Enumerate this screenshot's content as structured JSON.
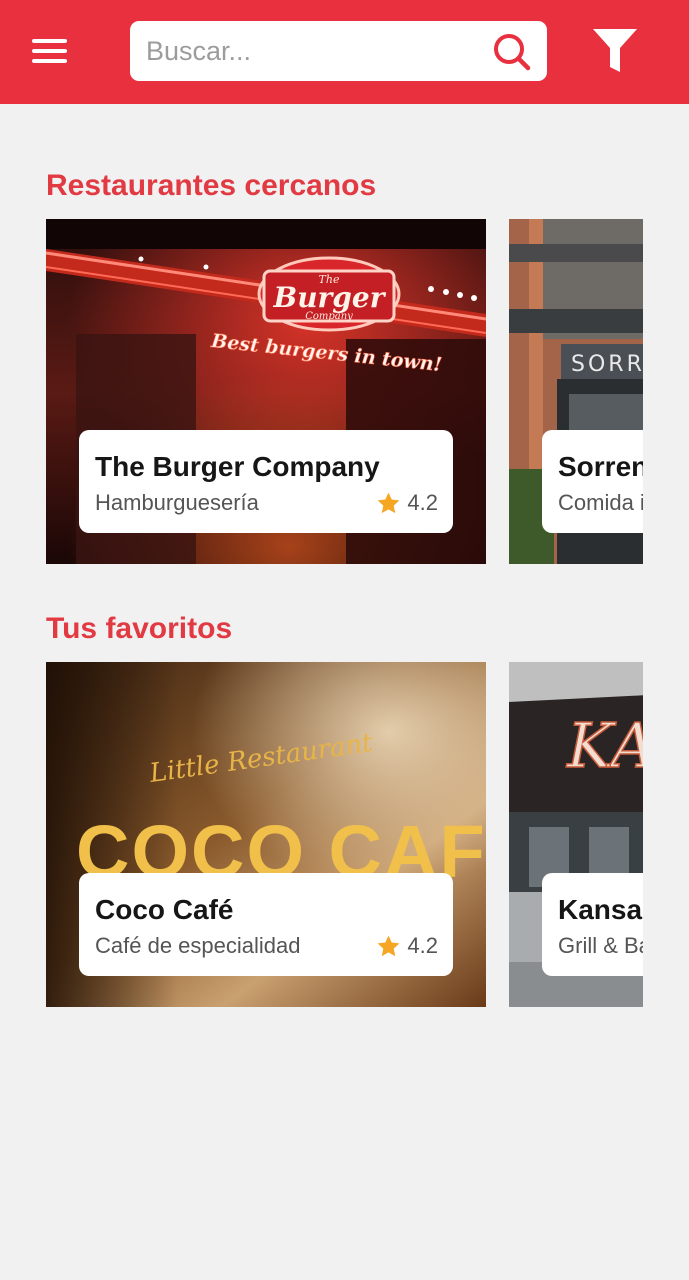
{
  "header": {
    "search_placeholder": "Buscar...",
    "menu_icon": "hamburger-menu-icon",
    "search_icon": "search-icon",
    "filter_icon": "filter-icon",
    "brand_color": "#e8303f"
  },
  "sections": [
    {
      "title": "Restaurantes cercanos",
      "cards": [
        {
          "name": "The Burger Company",
          "category": "Hamburguesería",
          "rating": "4.2",
          "sign_top": "The",
          "sign_main": "Burger",
          "sign_bottom": "Company",
          "neon": "Best burgers in town!"
        },
        {
          "name": "Sorrento",
          "category": "Comida italiana",
          "sign": "SORRENTO"
        }
      ]
    },
    {
      "title": "Tus favoritos",
      "cards": [
        {
          "name": "Coco Café",
          "category": "Café de especialidad",
          "rating": "4.2",
          "script": "Little Restaurant",
          "sign": "COCO CAFÉ"
        },
        {
          "name": "Kansas",
          "category": "Grill & Bar",
          "sign": "KANSAS"
        }
      ]
    }
  ],
  "colors": {
    "accent_text": "#e23a43",
    "star": "#f5a623",
    "background": "#f2f1f1"
  }
}
